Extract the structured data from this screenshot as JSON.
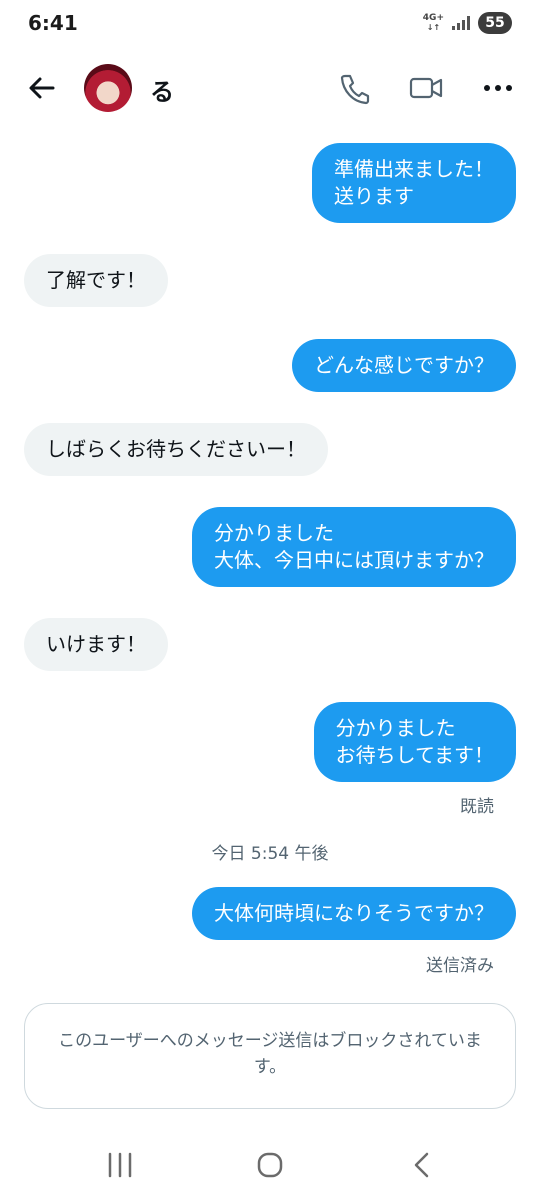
{
  "status_bar": {
    "time": "6:41",
    "network": "4G+",
    "battery": "55"
  },
  "header": {
    "contact_name": "る"
  },
  "messages": [
    {
      "direction": "out",
      "text": "準備出来ました！\n送ります"
    },
    {
      "direction": "in",
      "text": "了解です！"
    },
    {
      "direction": "out",
      "text": "どんな感じですか？"
    },
    {
      "direction": "in",
      "text": "しばらくお待ちくださいー！"
    },
    {
      "direction": "out",
      "text": "分かりました\n大体、今日中には頂けますか？"
    },
    {
      "direction": "in",
      "text": "いけます！"
    },
    {
      "direction": "out",
      "text": "分かりました\nお待ちしてます！"
    },
    {
      "direction": "out",
      "text": "大体何時頃になりそうですか？"
    }
  ],
  "read_receipt": "既読",
  "date_divider": "今日 5:54 午後",
  "sent_status": "送信済み",
  "blocked_notice": "このユーザーへのメッセージ送信はブロックされています。",
  "colors": {
    "outgoing_bubble": "#1d9bf0",
    "incoming_bubble": "#eff3f4",
    "meta_text": "#536471"
  }
}
